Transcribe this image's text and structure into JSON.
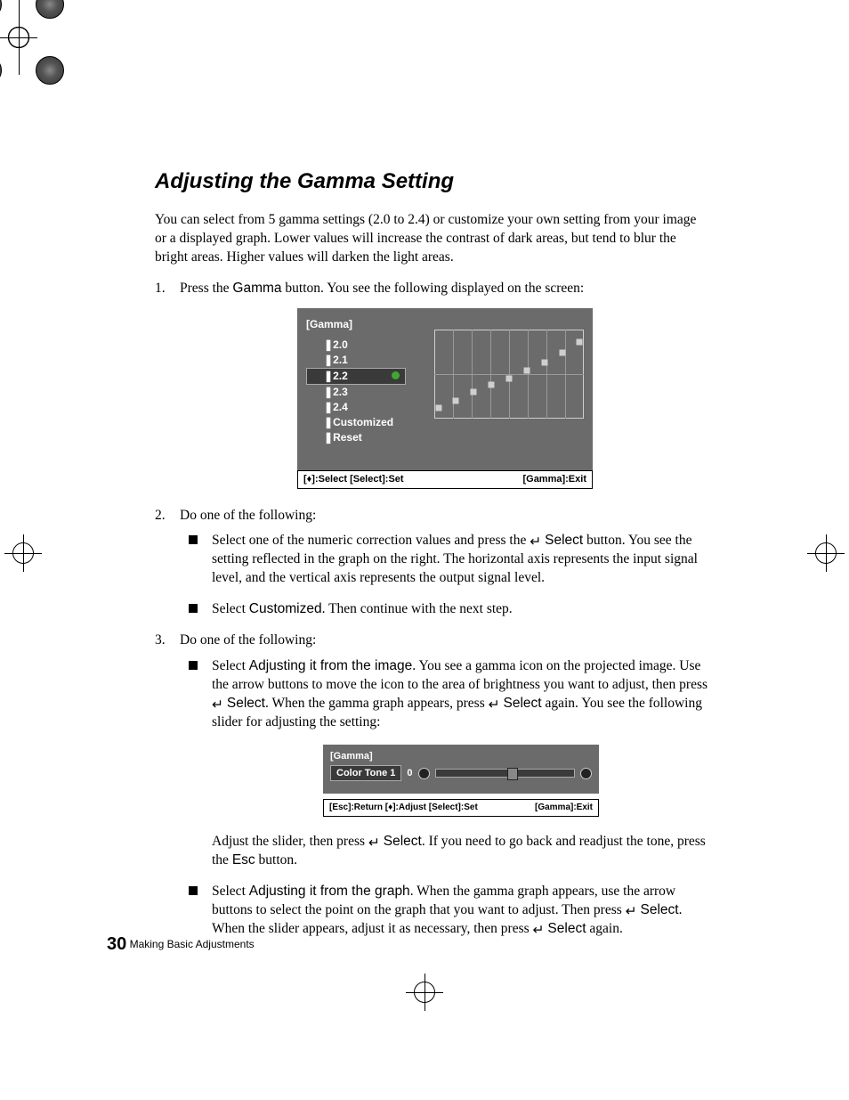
{
  "heading": "Adjusting the Gamma Setting",
  "intro": "You can select from 5 gamma settings (2.0 to 2.4) or customize your own setting from your image or a displayed graph. Lower values will increase the contrast of dark areas, but tend to blur the bright areas. Higher values will darken the light areas.",
  "steps": {
    "s1_pre": "Press the ",
    "s1_btn": "Gamma",
    "s1_post": " button. You see the following displayed on the screen:",
    "s2": "Do one of the following:",
    "s2a_pre": "Select one of the numeric correction values and press the ",
    "s2a_sel": "Select",
    "s2a_post": " button. You see the setting reflected in the graph on the right. The horizontal axis represents the input signal level, and the vertical axis represents the output signal level.",
    "s2b_pre": "Select ",
    "s2b_cust": "Customized",
    "s2b_post": ". Then continue with the next step.",
    "s3": "Do one of the following:",
    "s3a_pre": "Select ",
    "s3a_opt": "Adjusting it from the image",
    "s3a_mid1": ". You see a gamma icon on the projected image. Use the arrow buttons to move the icon to the area of brightness you want to adjust, then press ",
    "s3a_sel1": "Select",
    "s3a_mid2": ". When the gamma graph appears, press ",
    "s3a_sel2": "Select",
    "s3a_post": " again. You see the following slider for adjusting the setting:",
    "s3a2_pre": "Adjust the slider, then press ",
    "s3a2_sel": "Select",
    "s3a2_mid": ". If you need to go back and readjust the tone, press the ",
    "s3a2_esc": "Esc",
    "s3a2_post": " button.",
    "s3b_pre": "Select ",
    "s3b_opt": "Adjusting it from the graph",
    "s3b_mid1": ". When the gamma graph appears, use the arrow buttons to select the point on the graph that you want to adjust. Then press ",
    "s3b_sel1": "Select",
    "s3b_mid2": ". When the slider appears, adjust it as necessary, then press ",
    "s3b_sel2": "Select",
    "s3b_post": " again."
  },
  "osd1": {
    "title": "[Gamma]",
    "items": [
      "2.0",
      "2.1",
      "2.2",
      "2.3",
      "2.4",
      "Customized",
      "Reset"
    ],
    "selected": 2,
    "bar_left": "[♦]:Select [Select]:Set",
    "bar_right": "[Gamma]:Exit"
  },
  "osd2": {
    "title": "[Gamma]",
    "label": "Color Tone 1",
    "value": "0",
    "bar_left": "[Esc]:Return [♦]:Adjust [Select]:Set",
    "bar_right": "[Gamma]:Exit"
  },
  "footer": {
    "page_num": "30",
    "section": "Making Basic Adjustments"
  },
  "enter_glyph": "↵"
}
